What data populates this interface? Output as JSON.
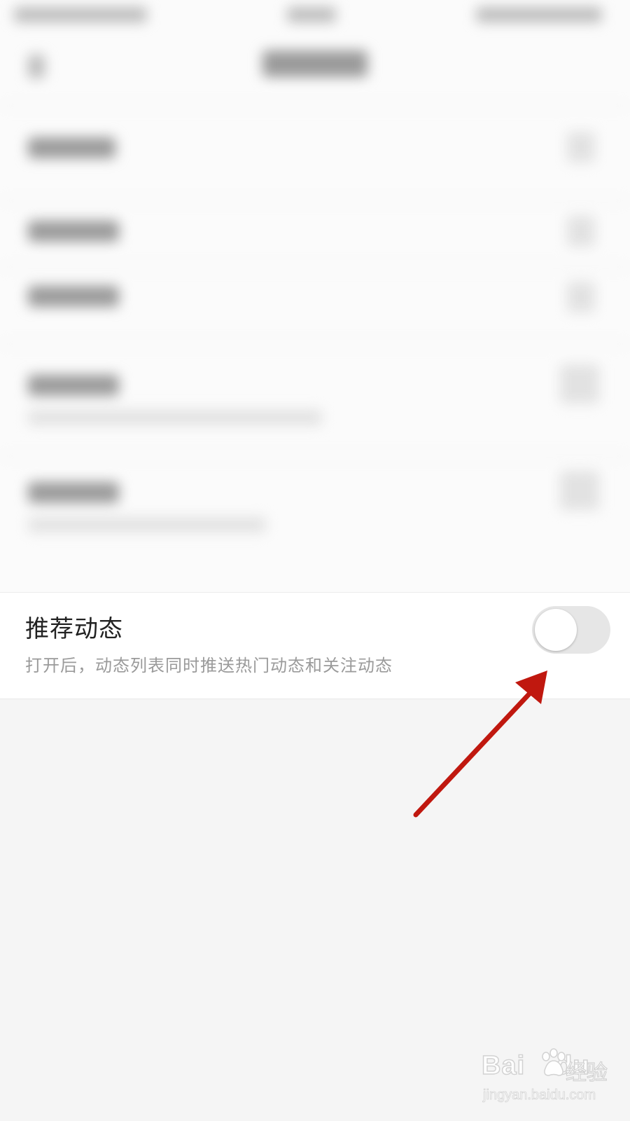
{
  "setting": {
    "title": "推荐动态",
    "description": "打开后，动态列表同时推送热门动态和关注动态",
    "toggle_on": false
  },
  "annotation": {
    "arrow_color": "#c0180f"
  },
  "watermark": {
    "logo": "Bai",
    "logo_suffix": "du",
    "cn": "经验",
    "url": "jingyan.baidu.com"
  },
  "colors": {
    "background": "#f5f5f5",
    "row_background": "#ffffff",
    "toggle_track": "#e6e6e6"
  }
}
